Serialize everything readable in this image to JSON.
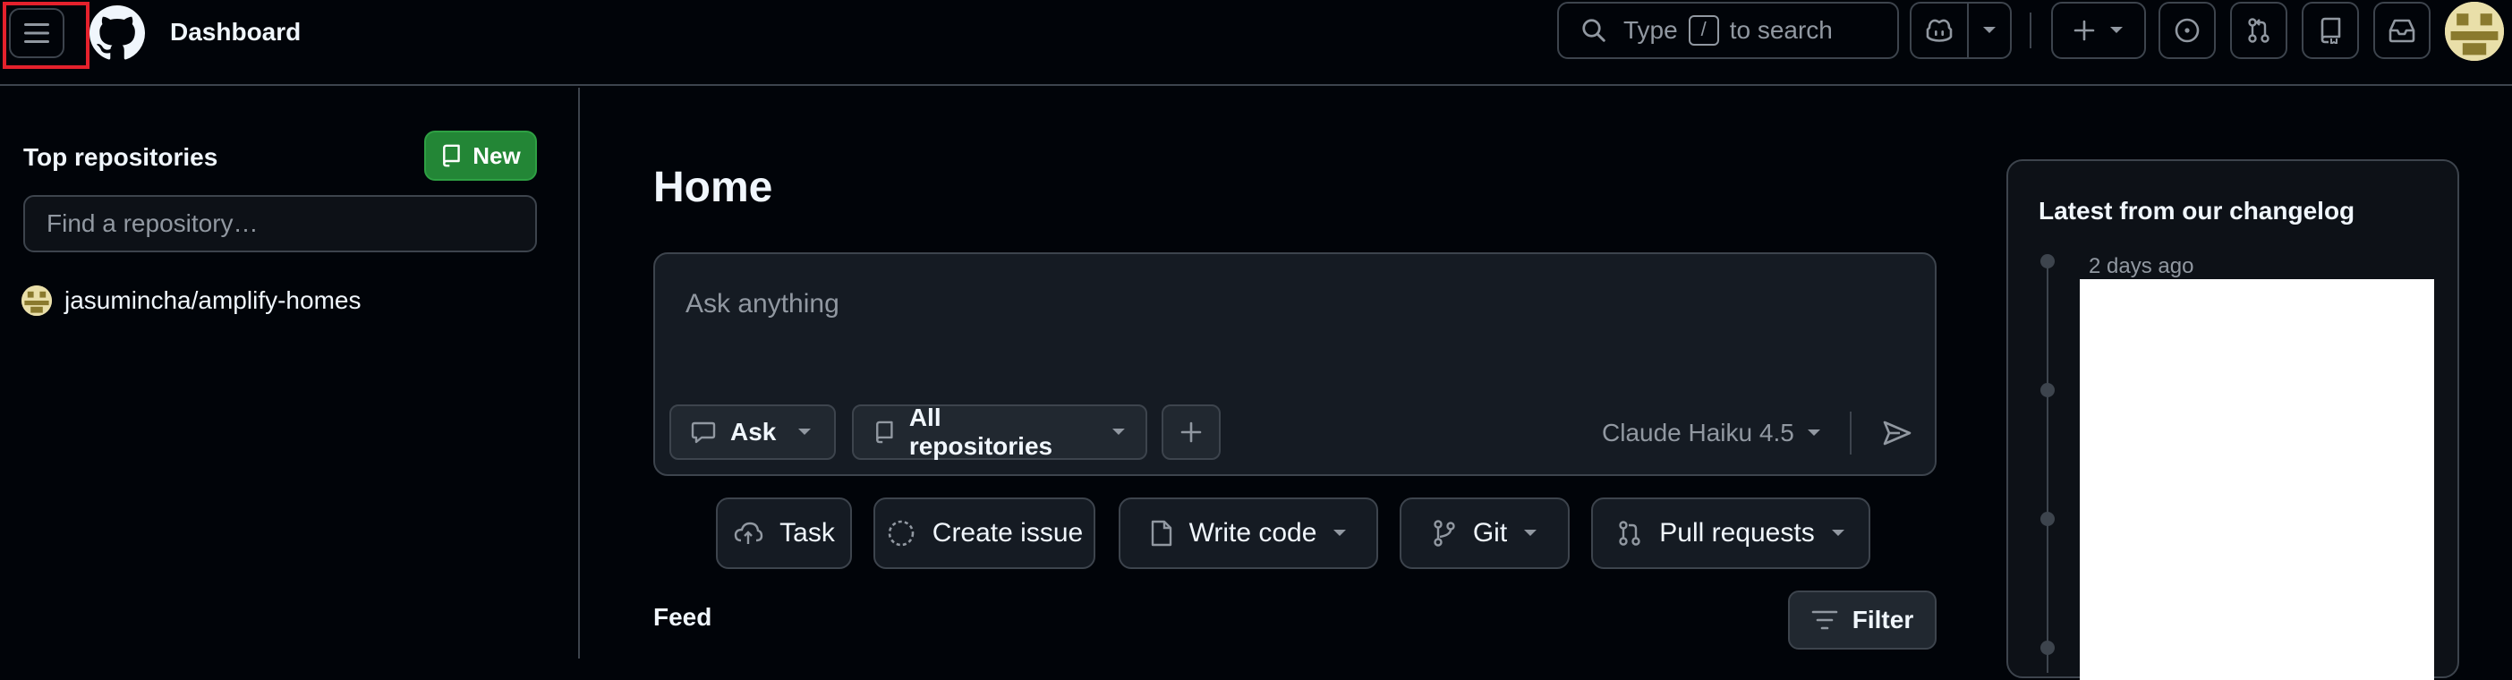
{
  "header": {
    "title": "Dashboard",
    "search": {
      "prefix": "Type",
      "key": "/",
      "suffix": "to search"
    },
    "icons": [
      "menu-icon",
      "github-logo-icon",
      "search-icon",
      "copilot-icon",
      "chevron-down-icon",
      "plus-icon",
      "issues-icon",
      "pull-requests-icon",
      "repo-icon",
      "inbox-icon"
    ]
  },
  "sidebar": {
    "title": "Top repositories",
    "new_button": "New",
    "find_placeholder": "Find a repository…",
    "repos": [
      {
        "name": "jasumincha/amplify-homes"
      }
    ]
  },
  "main": {
    "title": "Home",
    "ask": {
      "placeholder": "Ask anything",
      "mode": "Ask",
      "scope": "All repositories",
      "model": "Claude Haiku 4.5"
    },
    "quick_actions": [
      "Task",
      "Create issue",
      "Write code",
      "Git",
      "Pull requests"
    ],
    "feed_title": "Feed",
    "filter_button": "Filter"
  },
  "changelog": {
    "title": "Latest from our changelog",
    "first_date": "2 days ago"
  },
  "colors": {
    "background": "#010409",
    "panel": "#0d1117",
    "border": "#3d444d",
    "accent_green": "#238636",
    "focus_outline": "#e5212c"
  }
}
